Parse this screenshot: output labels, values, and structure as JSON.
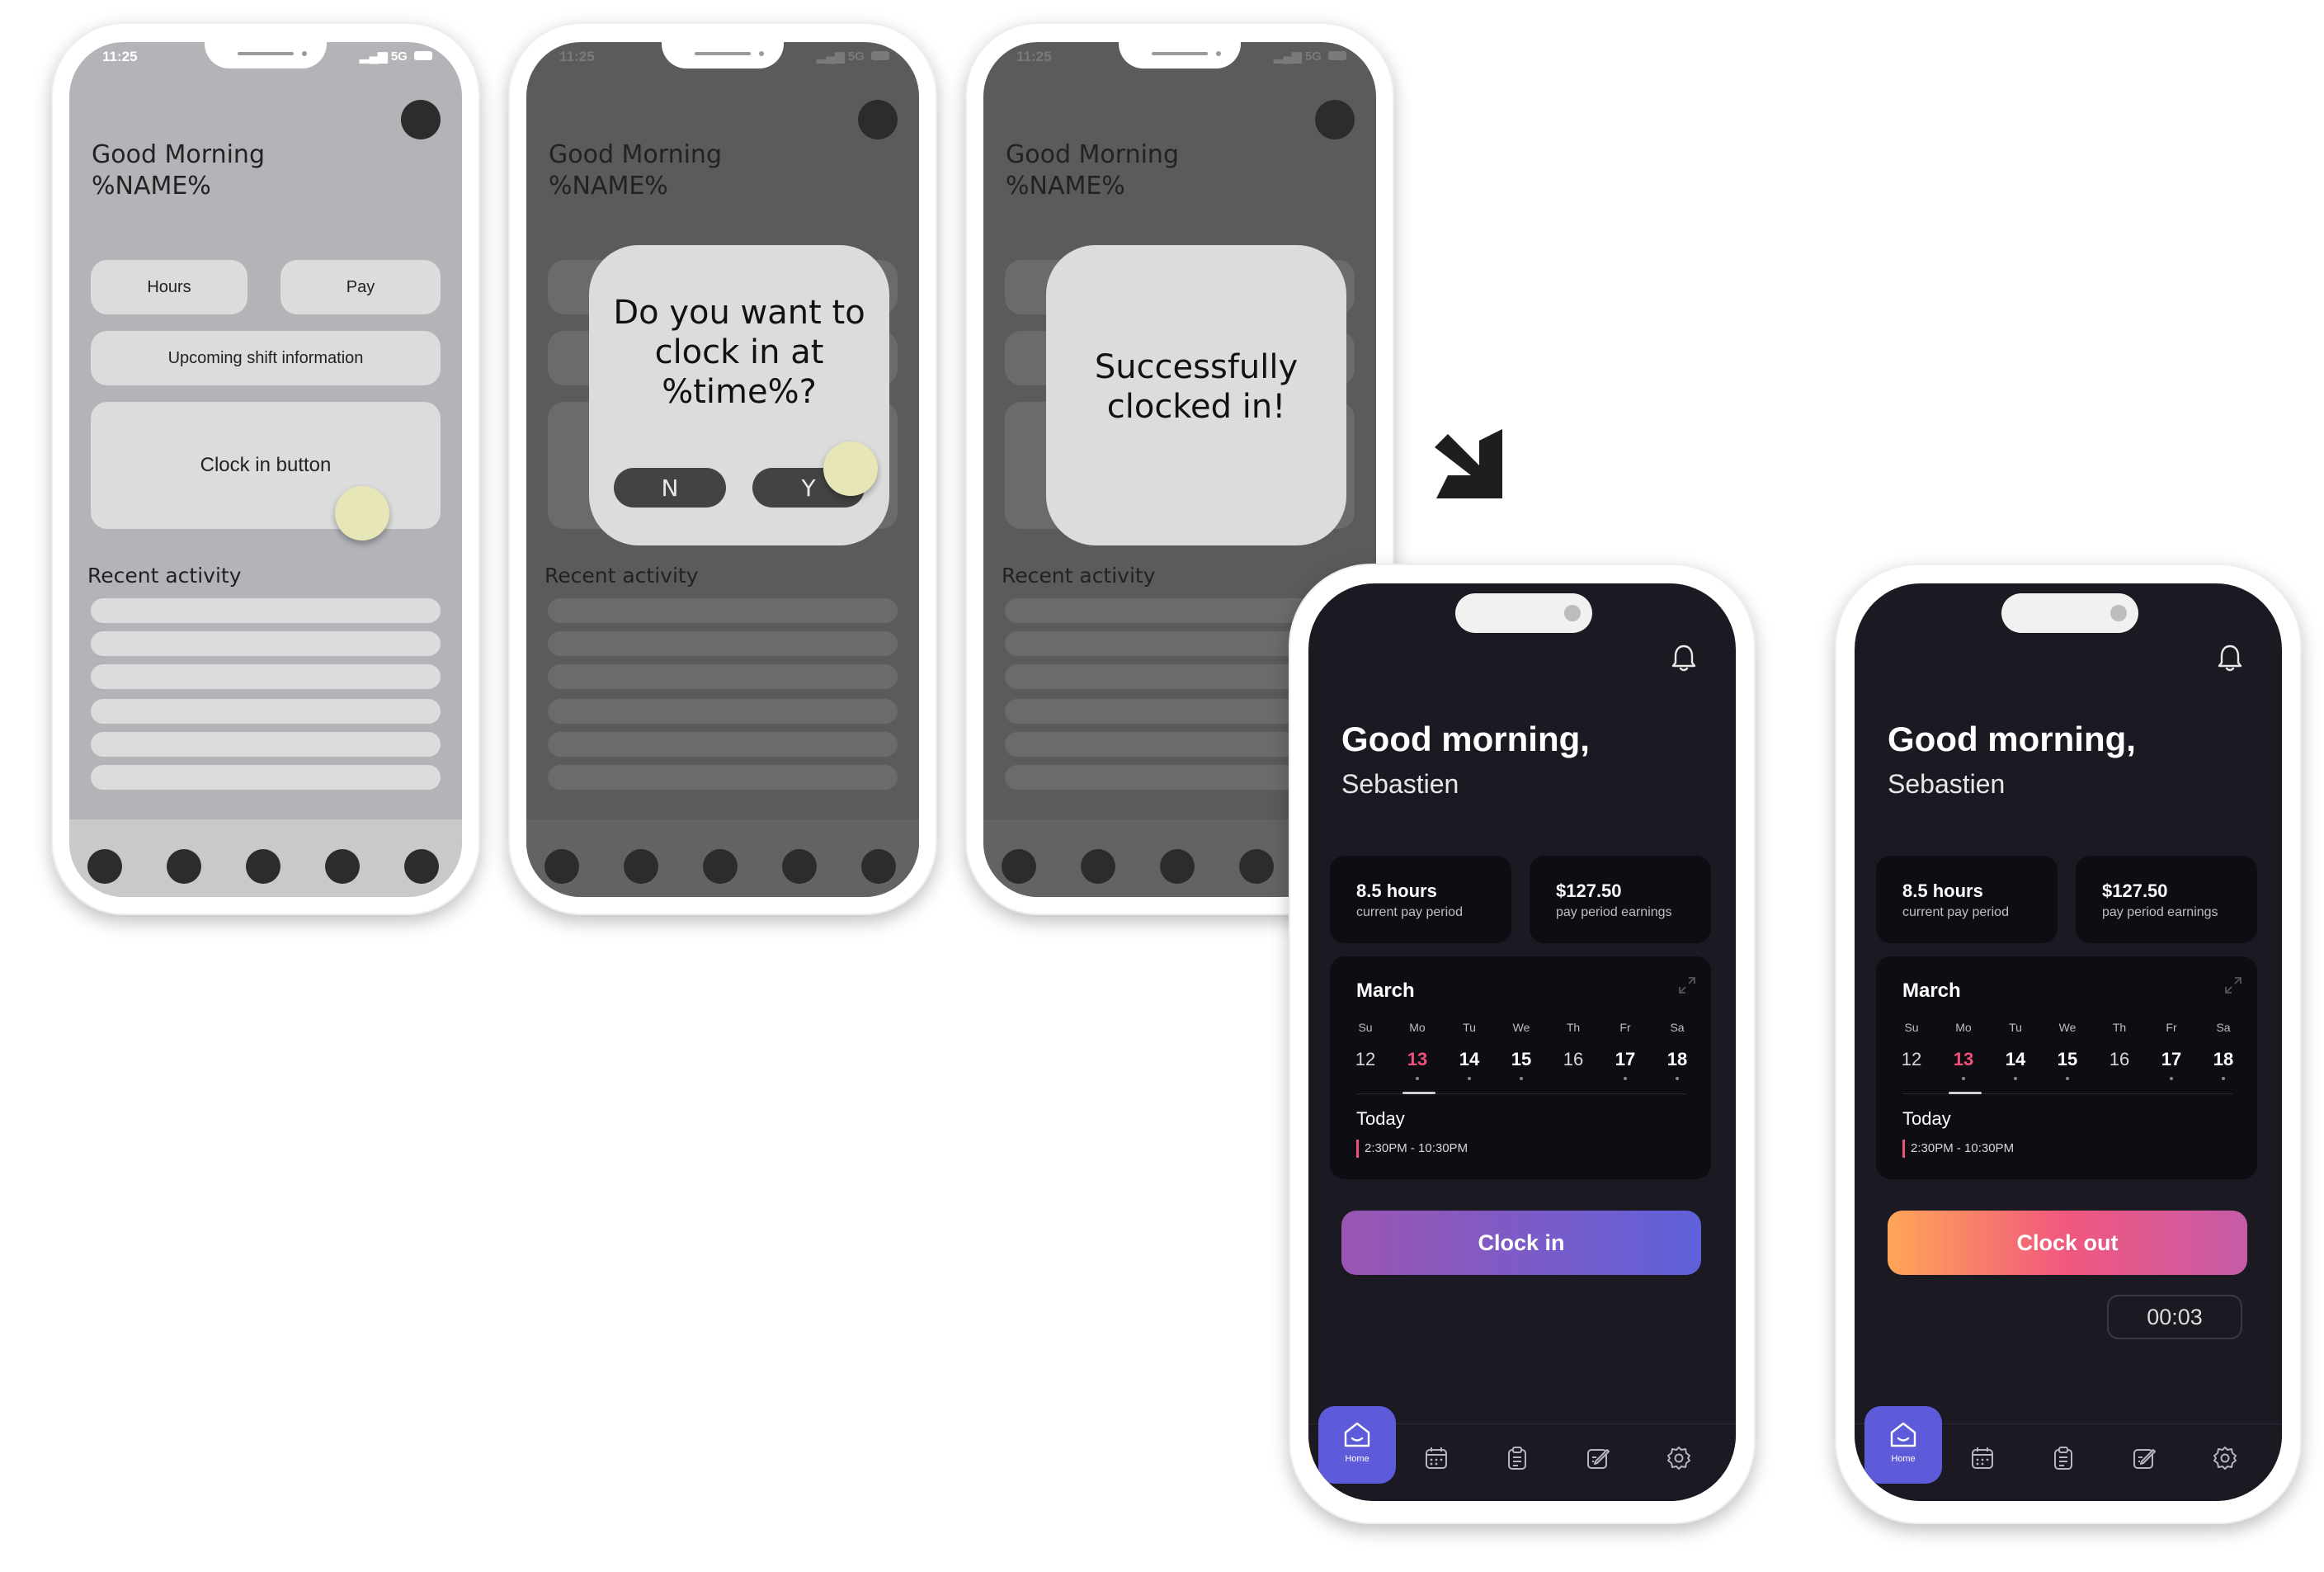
{
  "wireframes": [
    {
      "theme": "light",
      "status_time": "11:25",
      "status_signal": "5G",
      "greeting_line1": "Good Morning",
      "greeting_line2": "%NAME%",
      "hours_label": "Hours",
      "pay_label": "Pay",
      "upcoming_label": "Upcoming shift information",
      "clock_button_label": "Clock in button",
      "recent_label": "Recent activity"
    },
    {
      "theme": "dark",
      "status_time": "11:25",
      "status_signal": "5G",
      "greeting_line1": "Good Morning",
      "greeting_line2": "%NAME%",
      "recent_label": "Recent activity",
      "dialog": {
        "line1": "Do you want to",
        "line2": "clock in at",
        "line3": "%time%?",
        "no_label": "N",
        "yes_label": "Y"
      }
    },
    {
      "theme": "dark",
      "status_time": "11:25",
      "status_signal": "5G",
      "greeting_line1": "Good Morning",
      "greeting_line2": "%NAME%",
      "recent_label": "Recent activity",
      "success": {
        "line1": "Successfully",
        "line2": "clocked in!"
      }
    }
  ],
  "app": {
    "greeting": "Good morning,",
    "user_name": "Sebastien",
    "hours_value": "8.5 hours",
    "hours_caption": "current pay period",
    "earnings_value": "$127.50",
    "earnings_caption": "pay period earnings",
    "calendar": {
      "month": "March",
      "weekdays": [
        "Su",
        "Mo",
        "Tu",
        "We",
        "Th",
        "Fr",
        "Sa"
      ],
      "days": [
        "12",
        "13",
        "14",
        "15",
        "16",
        "17",
        "18"
      ],
      "selected_day": "13",
      "today_label": "Today",
      "shift_time": "2:30PM - 10:30PM"
    },
    "clock_in_label": "Clock in",
    "clock_out_label": "Clock out",
    "timer": "00:03",
    "nav_home_label": "Home"
  },
  "colors": {
    "dark_bg": "#1b1922",
    "card_bg": "#0e0d13",
    "accent_purple": "#5e5bda",
    "accent_pink": "#f0507a",
    "wireframe_light": "#b3b4b8",
    "wireframe_dark": "#5b5b5c",
    "tap_indicator": "#e6e6b6"
  },
  "icons": [
    "bell-icon",
    "expand-icon",
    "home-icon",
    "calendar-icon",
    "clipboard-icon",
    "edit-icon",
    "settings-icon",
    "arrow-icon"
  ]
}
